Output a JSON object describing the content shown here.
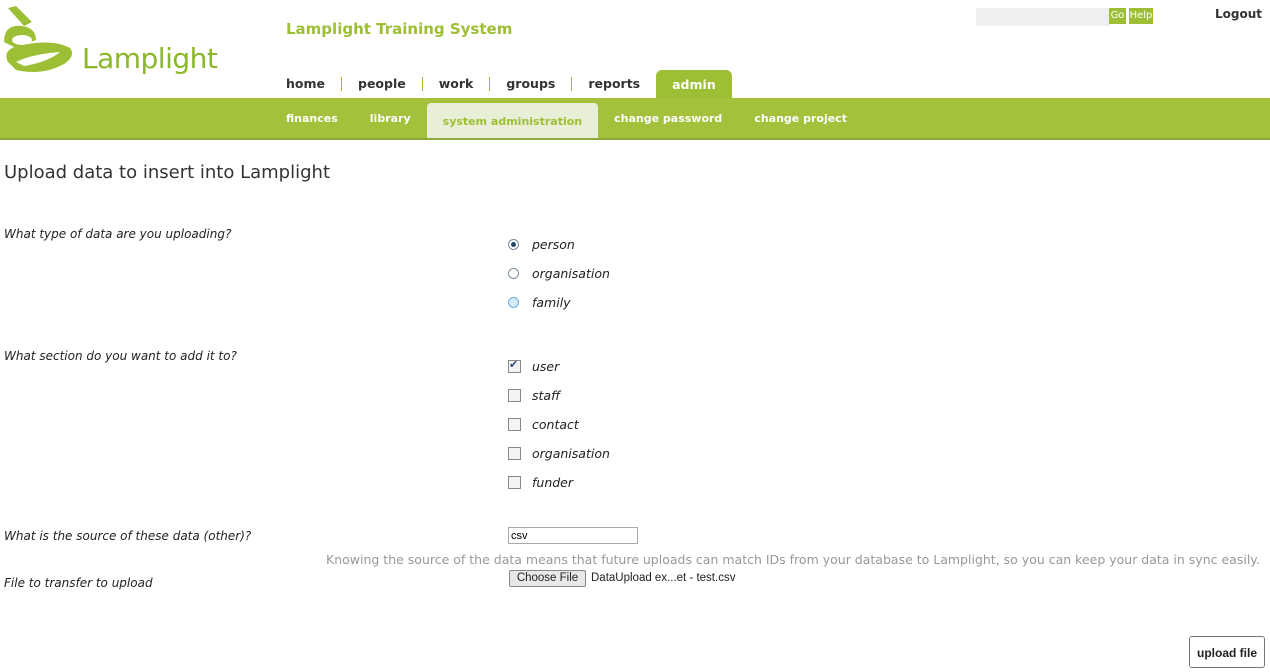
{
  "header": {
    "brand": "Lamplight",
    "system_title": "Lamplight Training System",
    "go_label": "Go",
    "help_label": "Help",
    "logout_label": "Logout"
  },
  "main_nav": [
    "home",
    "people",
    "work",
    "groups",
    "reports",
    "admin"
  ],
  "main_nav_active": "admin",
  "sub_nav": [
    "finances",
    "library",
    "system administration",
    "change password",
    "change project"
  ],
  "sub_nav_active": "system administration",
  "colors": {
    "accent": "#a3c13a",
    "accent_dark": "#9dbf35",
    "tab_light": "#e9efd6"
  },
  "page": {
    "title": "Upload data to insert into Lamplight",
    "q_type": "What type of data are you uploading?",
    "type_options": [
      {
        "label": "person",
        "selected": true
      },
      {
        "label": "organisation",
        "selected": false
      },
      {
        "label": "family",
        "selected": false
      }
    ],
    "q_section": "What section do you want to add it to?",
    "section_options": [
      {
        "label": "user",
        "checked": true
      },
      {
        "label": "staff",
        "checked": false
      },
      {
        "label": "contact",
        "checked": false
      },
      {
        "label": "organisation",
        "checked": false
      },
      {
        "label": "funder",
        "checked": false
      }
    ],
    "q_source": "What is the source of these data (other)?",
    "source_value": "csv",
    "source_hint": "Knowing the source of the data means that future uploads can match IDs from your database to Lamplight, so you can keep your data in sync easily.",
    "q_file": "File to transfer to upload",
    "choose_file_label": "Choose File",
    "file_name": "DataUpload ex...et - test.csv",
    "upload_label": "upload file"
  }
}
